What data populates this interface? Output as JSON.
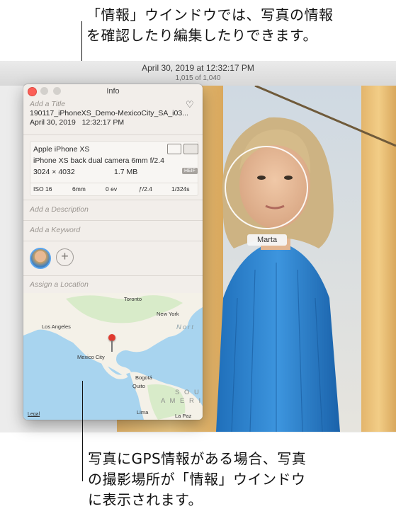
{
  "callouts": {
    "top_line1": "「情報」ウインドウでは、写真の情報",
    "top_line2": "を確認したり編集したりできます。",
    "bottom_line1": "写真にGPS情報がある場合、写真",
    "bottom_line2": "の撮影場所が「情報」ウインドウ",
    "bottom_line3": "に表示されます。"
  },
  "photos_window": {
    "title": "April 30, 2019 at 12:32:17 PM",
    "subtitle": "1,015 of 1,040"
  },
  "info_window": {
    "title": "Info",
    "title_placeholder": "Add a Title",
    "filename": "190117_iPhoneXS_Demo-MexicoCity_SA_i03...",
    "date": "April 30, 2019",
    "time": "12:32:17 PM",
    "camera": {
      "model": "Apple iPhone XS",
      "lens": "iPhone XS back dual camera 6mm f/2.4",
      "dimensions": "3024 × 4032",
      "size": "1.7 MB",
      "format": "HEIF"
    },
    "exif": {
      "iso": "ISO 16",
      "focal": "6mm",
      "ev": "0 ev",
      "aperture": "ƒ/2.4",
      "shutter": "1/324s"
    },
    "description_placeholder": "Add a Description",
    "keyword_placeholder": "Add a Keyword",
    "add_person": "+",
    "location_placeholder": "Assign a Location",
    "map": {
      "labels": {
        "toronto": "Toronto",
        "new_york": "New York",
        "los_angeles": "Los Angeles",
        "mexico_city": "Mexico City",
        "bogota": "Bogotá",
        "quito": "Quito",
        "lima": "Lima",
        "la_paz": "La Paz",
        "north": "Nort",
        "south_line1": "S O U T",
        "south_line2": "A M E R I"
      },
      "legal": "Legal"
    }
  },
  "face_tag": {
    "name": "Marta"
  },
  "colors": {
    "accent": "#5aa5ee",
    "close": "#fc5f57",
    "pin": "#e03a2f"
  }
}
